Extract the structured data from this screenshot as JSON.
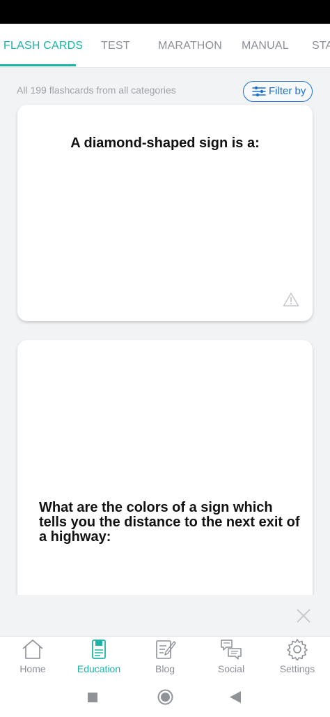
{
  "tabs": [
    {
      "label": "FLASH CARDS",
      "active": true
    },
    {
      "label": "TEST",
      "active": false
    },
    {
      "label": "MARATHON",
      "active": false
    },
    {
      "label": "MANUAL",
      "active": false
    },
    {
      "label": "STA",
      "active": false
    }
  ],
  "subheader": {
    "count_text": "All 199 flashcards from all categories",
    "filter_label": "Filter by"
  },
  "cards": [
    {
      "question": "A diamond-shaped sign is a:"
    },
    {
      "question": "What are the colors of a sign which tells you the distance to the next exit of a highway:"
    }
  ],
  "bottom_nav": [
    {
      "label": "Home",
      "icon": "home-icon"
    },
    {
      "label": "Education",
      "icon": "education-icon",
      "active": true
    },
    {
      "label": "Blog",
      "icon": "blog-icon"
    },
    {
      "label": "Social",
      "icon": "social-icon"
    },
    {
      "label": "Settings",
      "icon": "settings-icon"
    }
  ],
  "colors": {
    "accent": "#1bb5a6",
    "filter_blue": "#1a6fd0",
    "background": "#f2f3f5"
  }
}
